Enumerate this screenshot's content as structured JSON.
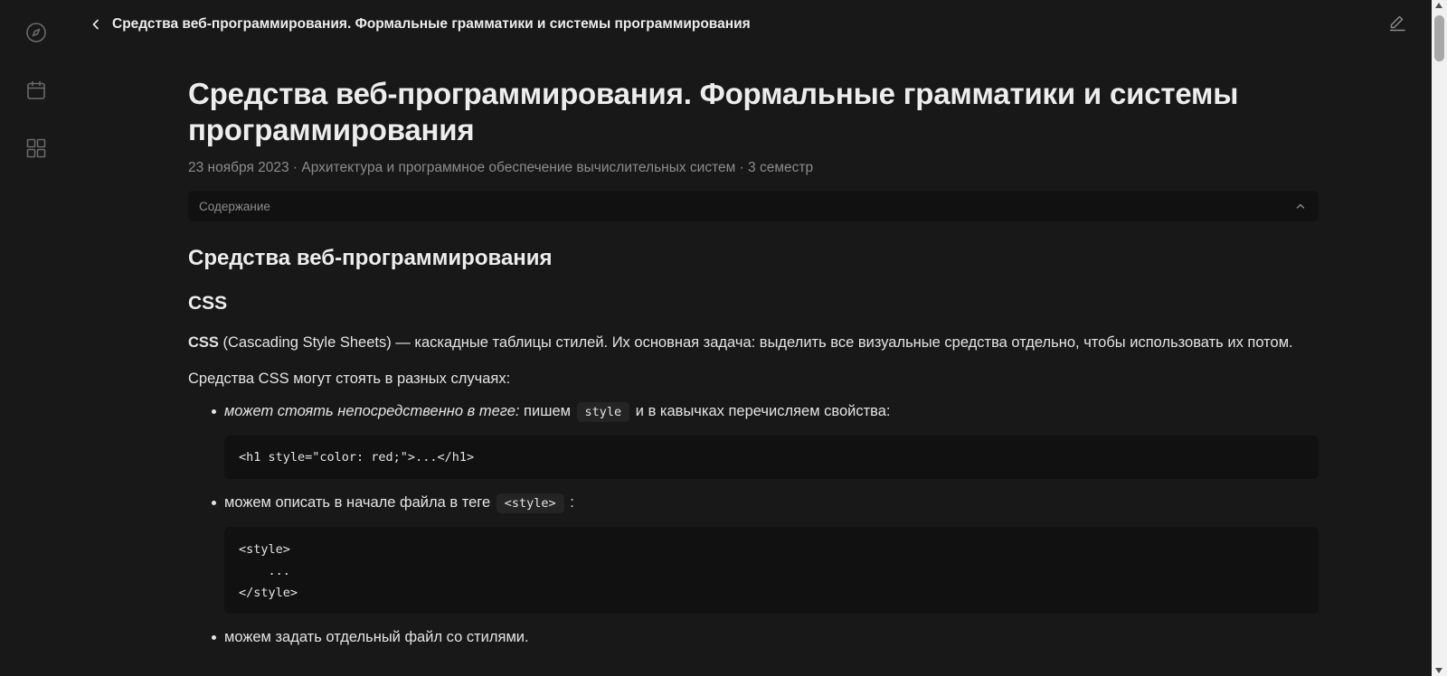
{
  "topbar": {
    "title": "Средства веб-программирования. Формальные грамматики и системы программирования"
  },
  "sidebar": {
    "icons": [
      "compass-icon",
      "calendar-icon",
      "grid-icon"
    ]
  },
  "article": {
    "title": "Средства веб-программирования. Формальные грамматики и системы программирования",
    "meta": "23 ноября 2023 · Архитектура и программное обеспечение вычислительных систем · 3 семестр",
    "toc_label": "Содержание",
    "h2": "Средства веб-программирования",
    "h3": "CSS",
    "intro_bold": "CSS",
    "intro_rest": " (Cascading Style Sheets) — каскадные таблицы стилей. Их основная задача: выделить все визуальные средства отдельно, чтобы использовать их потом.",
    "para2": "Средства CSS могут стоять в разных случаях:",
    "items": [
      {
        "italic": "может стоять непосредственно в теге:",
        "text_before": " пишем ",
        "code": "style",
        "text_after": " и в кавычках перечисляем свойства:",
        "block": "<h1 style=\"color: red;\">...</h1>"
      },
      {
        "text_before": "можем описать в начале файла в теге ",
        "code": "<style>",
        "text_after": " :",
        "block": "<style>\n    ...\n</style>"
      },
      {
        "text": "можем задать отдельный файл со стилями."
      }
    ]
  },
  "colors": {
    "background": "#181818",
    "panel": "#111111",
    "text": "#e4e4e4",
    "muted": "#8c8c8c"
  }
}
